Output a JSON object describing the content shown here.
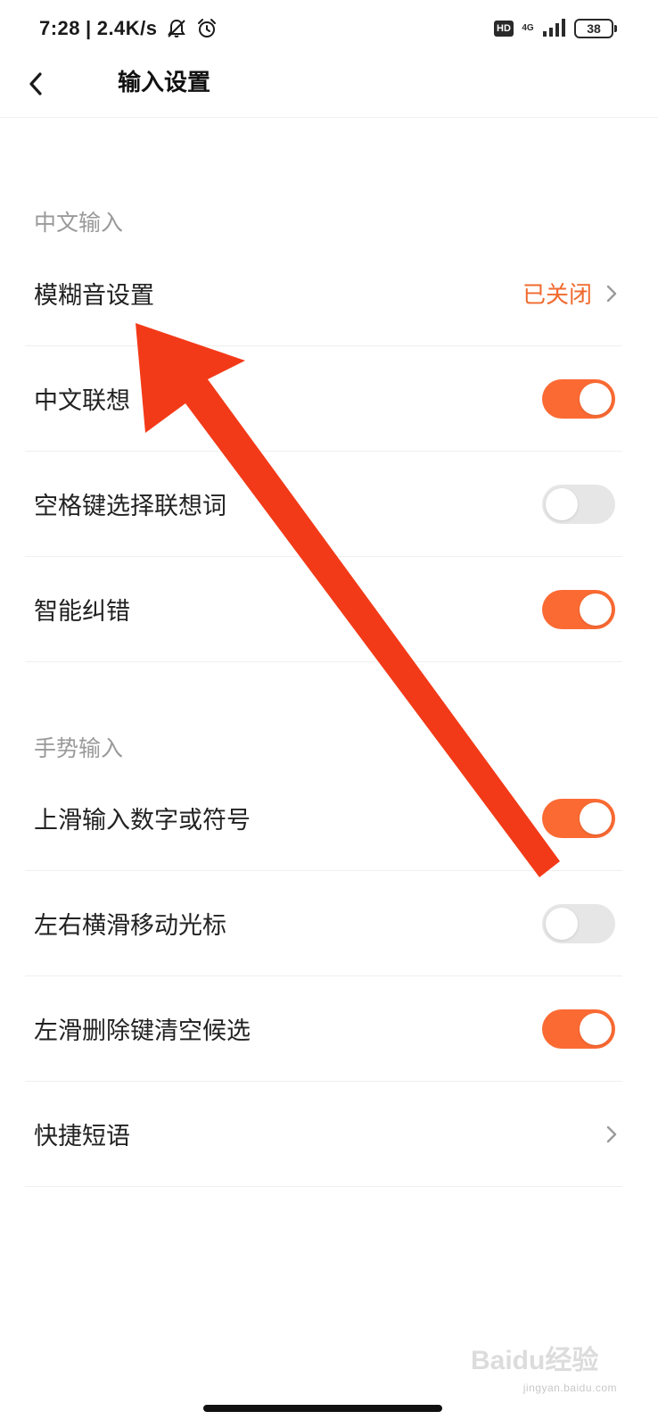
{
  "status_bar": {
    "time": "7:28",
    "separator": "|",
    "net_speed": "2.4K/s",
    "hd": "HD",
    "network": "4G",
    "battery": "38"
  },
  "header": {
    "title": "输入设置"
  },
  "sections": {
    "chinese": {
      "title": "中文输入",
      "fuzzy": {
        "label": "模糊音设置",
        "value": "已关闭"
      },
      "association": {
        "label": "中文联想",
        "on": true
      },
      "space_select": {
        "label": "空格键选择联想词",
        "on": false
      },
      "autocorrect": {
        "label": "智能纠错",
        "on": true
      }
    },
    "gesture": {
      "title": "手势输入",
      "swipe_up": {
        "label": "上滑输入数字或符号",
        "on": true
      },
      "swipe_cursor": {
        "label": "左右横滑移动光标",
        "on": false
      },
      "swipe_delete": {
        "label": "左滑删除键清空候选",
        "on": true
      },
      "phrases": {
        "label": "快捷短语"
      }
    }
  },
  "colors": {
    "accent": "#fb6a33",
    "value_text": "#f06a2e",
    "annotation": "#f33a18"
  },
  "watermark": {
    "logo": "Baidu经验",
    "url": "jingyan.baidu.com"
  }
}
